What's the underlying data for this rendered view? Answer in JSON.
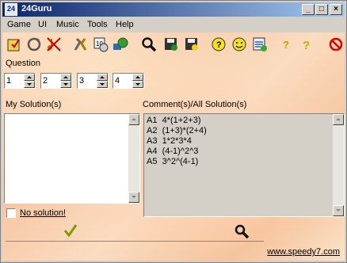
{
  "window": {
    "title": "24Guru",
    "icon": "app-icon",
    "controls": [
      "minimize",
      "maximize",
      "close"
    ]
  },
  "menu": [
    "Game",
    "UI",
    "Music",
    "Tools",
    "Help"
  ],
  "toolbar": [
    "new-game-icon",
    "refresh-icon",
    "no-music-icon",
    "tools-icon",
    "timer-icon",
    "globe-icon",
    "search-icon",
    "save-icon",
    "save-smile-icon",
    "help-icon",
    "smile-icon",
    "chart-icon",
    "question-icon",
    "question-alt-icon",
    "stop-icon"
  ],
  "question": {
    "label": "Question",
    "values": [
      "1",
      "2",
      "3",
      "4"
    ]
  },
  "my_solutions": {
    "label": "My Solution(s)",
    "value": ""
  },
  "comments": {
    "label": "Comment(s)/All Solution(s)",
    "lines": [
      "A1  4*(1+2+3)",
      "A2  (1+3)*(2+4)",
      "A3  1*2*3*4",
      "A4  (4-1)^2^3",
      "A5  3^2^(4-1)"
    ]
  },
  "no_solution": {
    "label": "No solution!",
    "checked": false
  },
  "actions": {
    "check": "check-icon",
    "solve": "magnify-icon"
  },
  "link": "www.speedy7.com",
  "colors": {
    "title_start": "#0a246a",
    "title_end": "#a6caf0",
    "face": "#d4d0c8",
    "check": "#7aa000"
  }
}
